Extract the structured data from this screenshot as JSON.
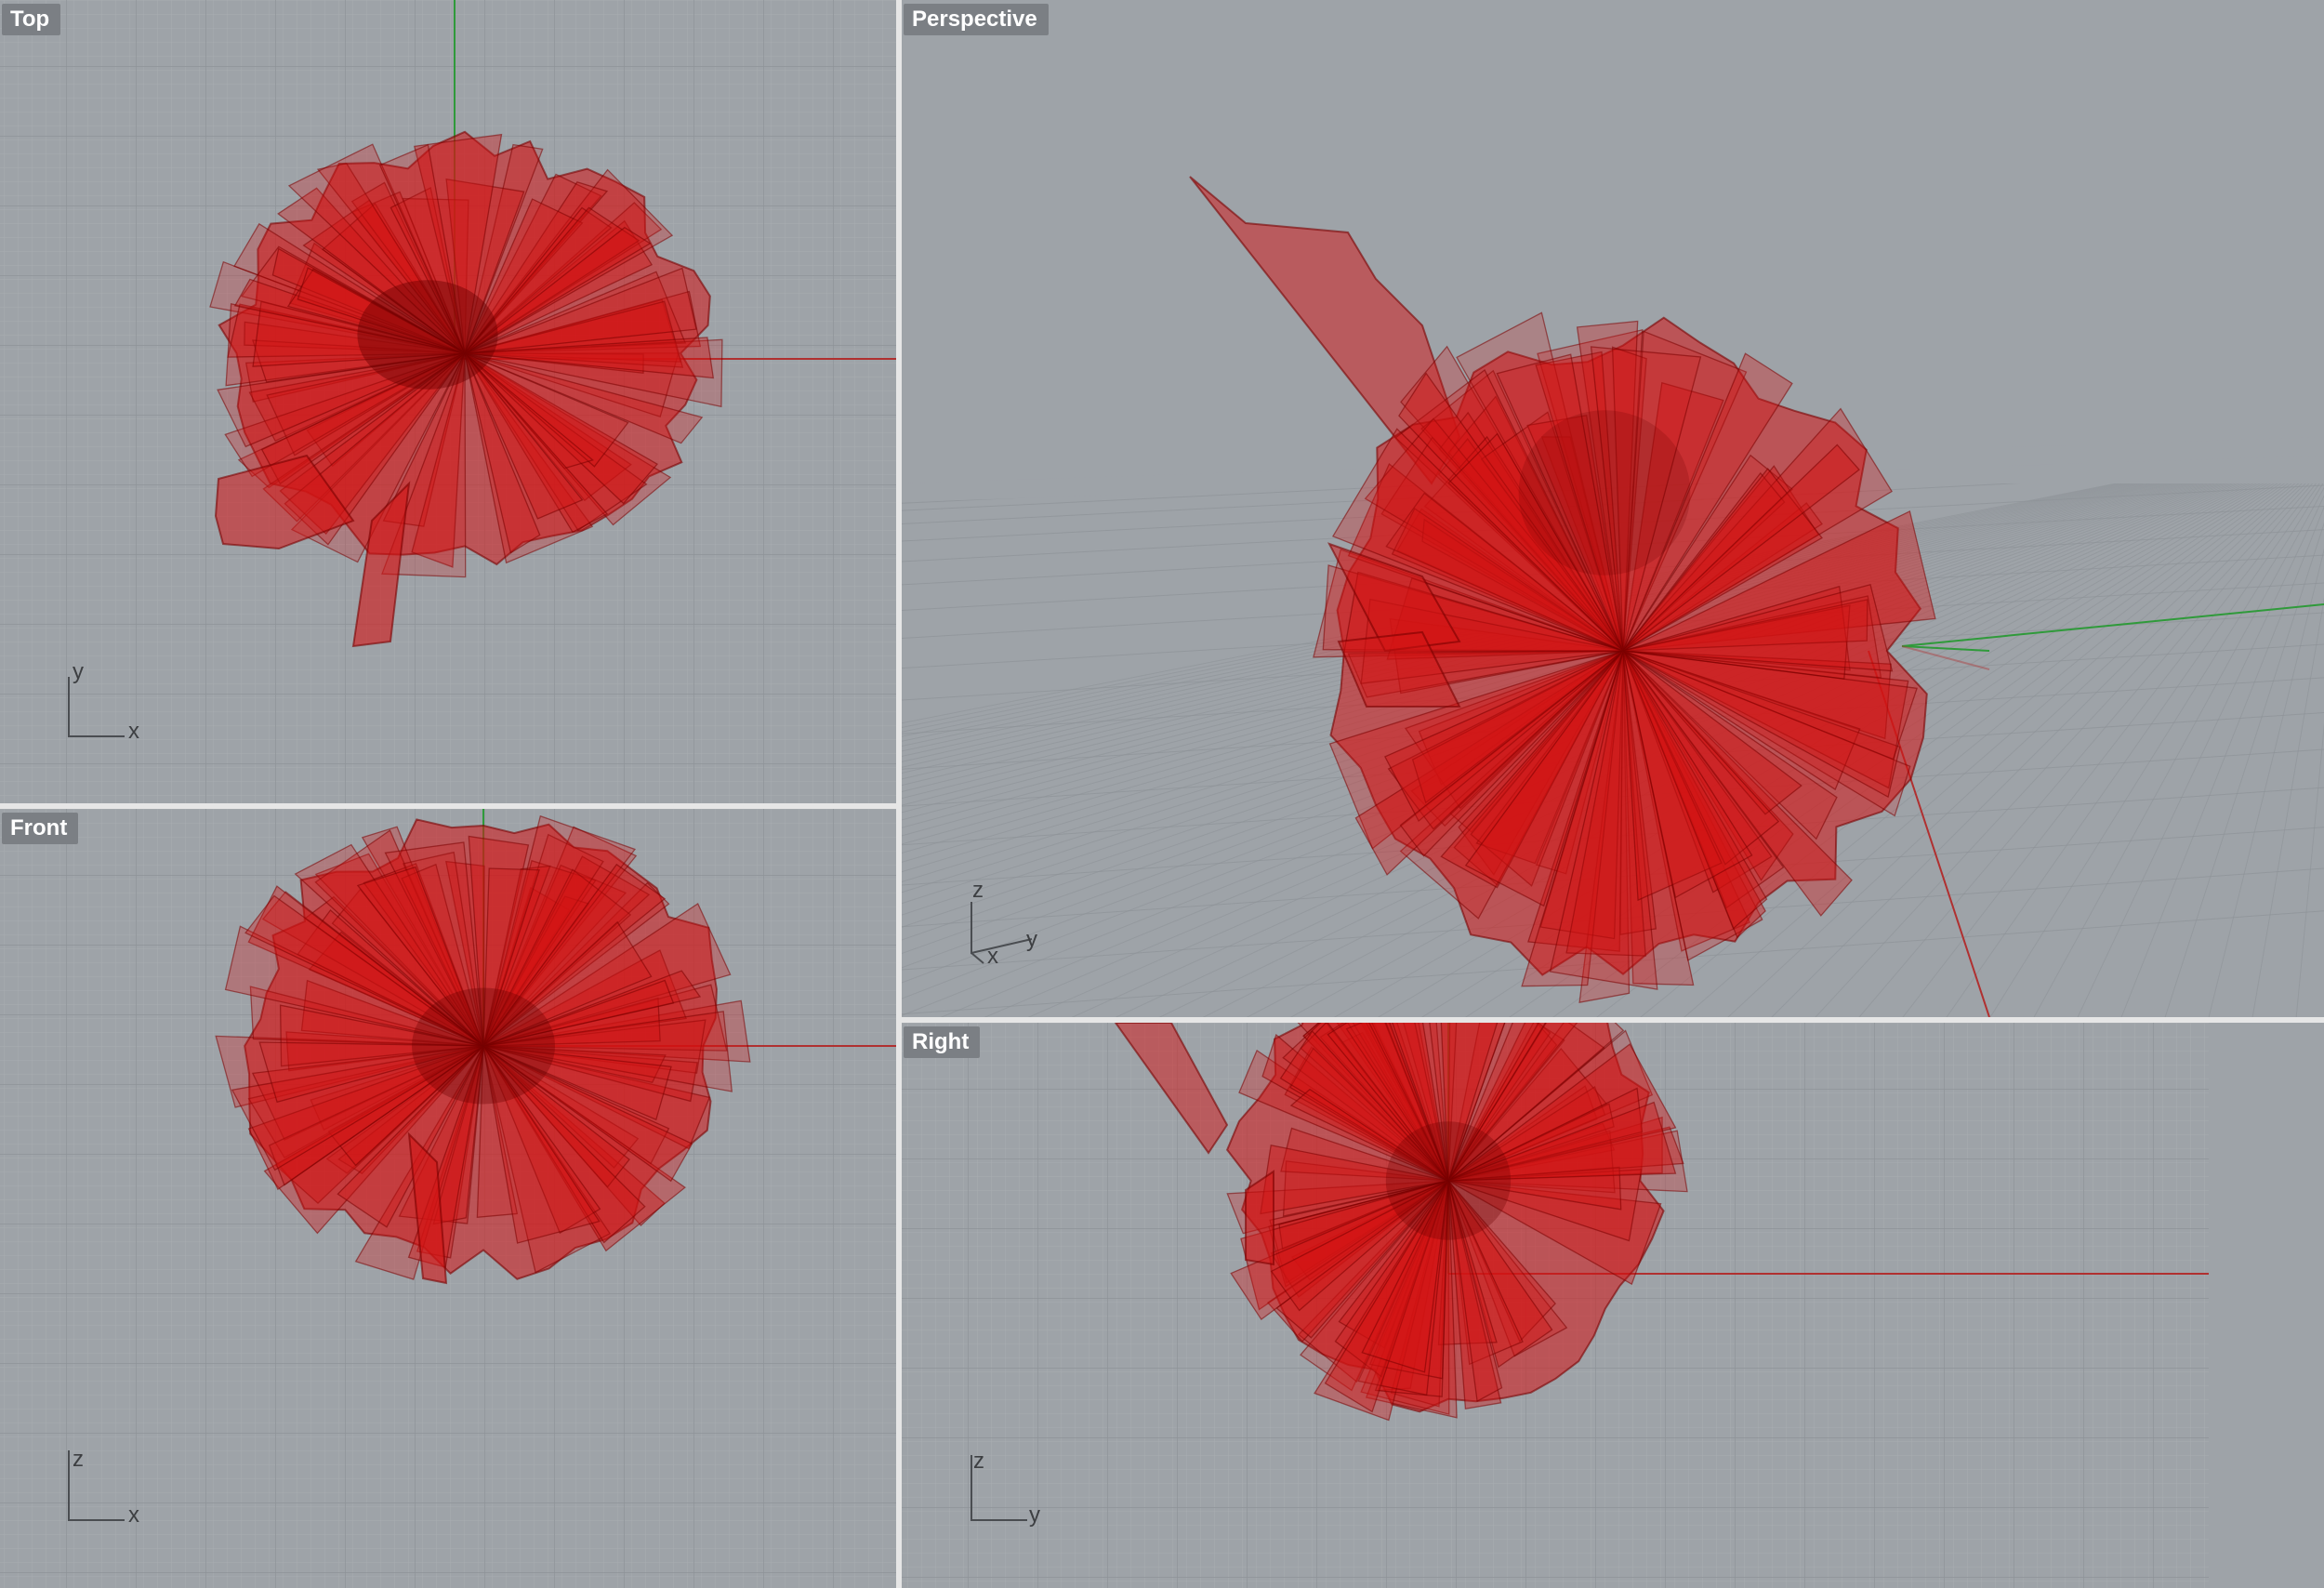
{
  "viewports": {
    "top": {
      "title": "Top",
      "axis_v": "y",
      "axis_h": "x"
    },
    "perspective": {
      "title": "Perspective",
      "axis_v": "z",
      "axis_h": "y",
      "axis_d": "x"
    },
    "front": {
      "title": "Front",
      "axis_v": "z",
      "axis_h": "x"
    },
    "right": {
      "title": "Right",
      "axis_v": "z",
      "axis_h": "y"
    }
  },
  "colors": {
    "background": "#9ea3a8",
    "grid_minor": "#a7abb0",
    "grid_major": "#8e9398",
    "axis_x": "#b03030",
    "axis_y": "#2f9a3a",
    "object": "#d41414",
    "object_edge": "#7a0000",
    "title_bg": "#7b7f84",
    "title_text": "#ffffff",
    "divider": "#e6e6e6"
  },
  "icons": {
    "object": "red-flower-surface",
    "axis_widget": "axis-gizmo"
  }
}
